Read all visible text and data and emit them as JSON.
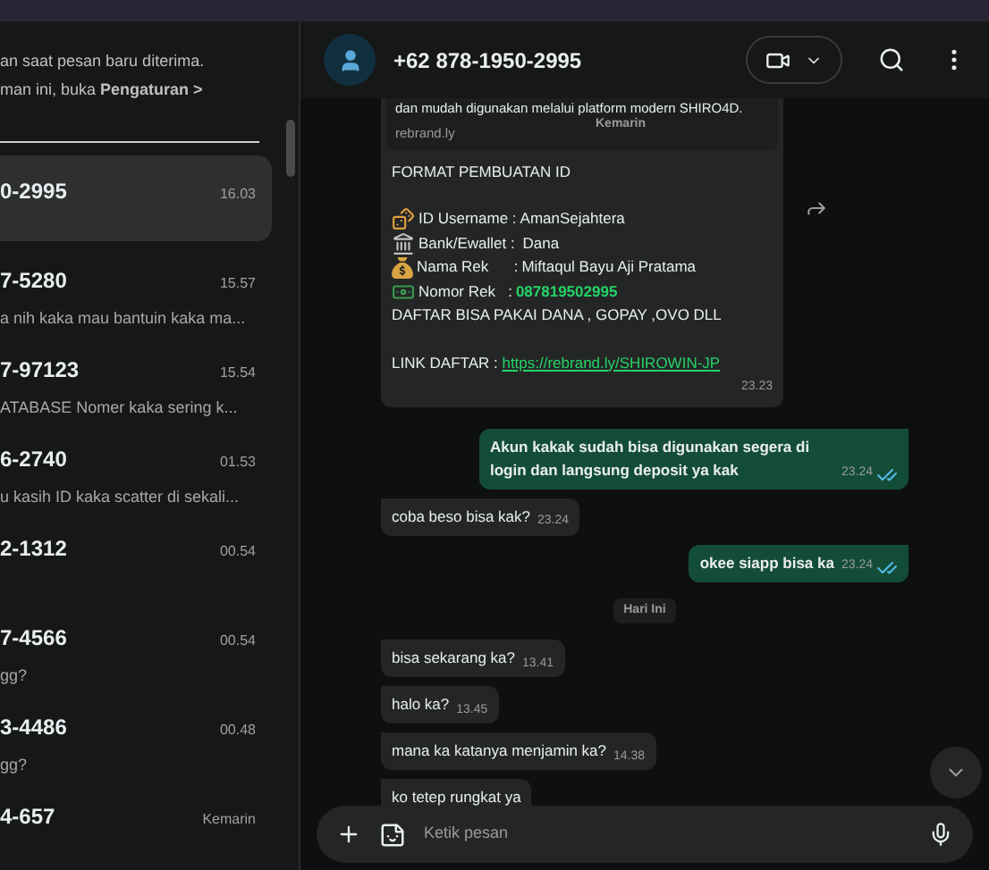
{
  "notice": {
    "lines": [
      "an saat pesan baru diterima.",
      "man ini, buka **Pengaturan >**"
    ]
  },
  "chat_list": [
    {
      "name": "0-2995",
      "time": "16.03",
      "selected": true
    },
    {
      "name": "7-5280",
      "time": "15.57",
      "preview": "a nih kaka mau bantuin kaka ma...",
      "selected": false
    },
    {
      "name": "7-97123",
      "time": "15.54",
      "preview": "ATABASE Nomer kaka sering k...",
      "selected": false
    },
    {
      "name": "6-2740",
      "time": "01.53",
      "preview": "u kasih ID kaka scatter di sekali...",
      "selected": false
    },
    {
      "name": "2-1312",
      "time": "00.54",
      "selected": false
    },
    {
      "name": "7-4566",
      "time": "00.54",
      "preview": "gg?",
      "selected": false
    },
    {
      "name": "3-4486",
      "time": "00.48",
      "preview": "gg?",
      "selected": false
    },
    {
      "name": "4-657",
      "time": "Kemarin",
      "selected": false
    }
  ],
  "chat_header": {
    "title": "+62 878-1950-2995"
  },
  "first_message": {
    "preview_text": "dan mudah digunakan melalui platform modern SHIRO4D.",
    "preview_domain": "rebrand.ly",
    "date_chip": "Kemarin",
    "heading": "FORMAT PEMBUATAN ID",
    "fields": [
      {
        "label": "ID Username :",
        "value": "AmanSejahtera",
        "highlight": false
      },
      {
        "label": "Bank/Ewallet : ",
        "value": "Dana",
        "highlight": false
      },
      {
        "label": "Nama Rek      :",
        "value": "Miftaqul Bayu Aji Pratama",
        "highlight": false
      },
      {
        "label": "Nomor Rek   :",
        "value": "087819502995",
        "highlight": true
      }
    ],
    "note": "DAFTAR BISA PAKAI DANA , GOPAY ,OVO DLL",
    "link_label": "LINK DAFTAR : ",
    "link": "https://rebrand.ly/SHIROWIN-JP",
    "time": "23.23"
  },
  "messages": [
    {
      "kind": "message",
      "outgoing": true,
      "text": "Akun kakak sudah bisa digunakan segera di login dan langsung deposit ya kak",
      "time": "23.24",
      "read": true
    },
    {
      "kind": "message",
      "outgoing": false,
      "text": "coba beso bisa kak?",
      "time": "23.24"
    },
    {
      "kind": "message",
      "outgoing": true,
      "text": "okee siapp bisa ka",
      "time": "23.24",
      "read": true
    },
    {
      "kind": "date",
      "text": "Hari Ini"
    },
    {
      "kind": "message",
      "outgoing": false,
      "text": "bisa sekarang ka?",
      "time": "13.41"
    },
    {
      "kind": "message",
      "outgoing": false,
      "text": "halo ka?",
      "time": "13.45"
    },
    {
      "kind": "message",
      "outgoing": false,
      "text": "mana ka katanya menjamin ka?",
      "time": "14.38"
    },
    {
      "kind": "message",
      "outgoing": false,
      "text": "ko tetep rungkat ya"
    }
  ],
  "composer": {
    "placeholder": "Ketik pesan"
  }
}
